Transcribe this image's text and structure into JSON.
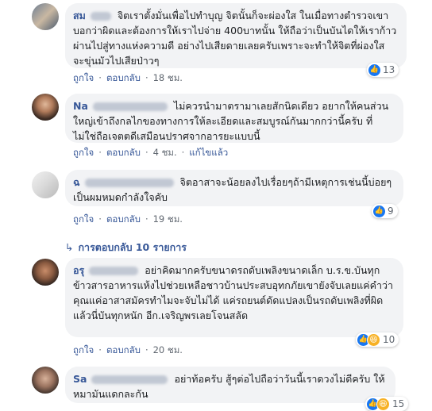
{
  "actions": {
    "like": "ถูกใจ",
    "reply": "ตอบกลับ",
    "edited": "แก้ไขแล้ว"
  },
  "comments": [
    {
      "name": "สม",
      "text": "จิตเราตั้งมั่นเพื่อไปทำบุญ จิตนั้นก็จะผ่องใส ในเมื่อทางตำรวจเขาบอกว่าผิดและต้องการให้เราไปจ่าย 400บาทนั้น ให้ถือว่าเป็นบันไดให้เราก้าวผ่านไปสู่ทางแห่งความดี อย่างไปเสียดายเลยครับเพราะจะทำให้จิตที่ผ่องใส จะขุ่นมัวไปเสียป่าวๆ",
      "time": "18 ชม.",
      "reactions": "13"
    },
    {
      "name": "Na",
      "text": "ไม่ควรนำมาตรามาเลยสักนิดเดียว อยากให้คนส่วนใหญ่เข้าถึงกลไกของทางการให้ละเอียดและสมบูรณ์กันมากกว่านี้ครับ ที่ไม่ใช่ถือเจตตดีเสมือนปราศจากอารยะแบบนี้",
      "time": "4 ชม.",
      "reactions": ""
    },
    {
      "name": "ฉ",
      "text": "จิตอาสาจะน้อยลงไปเรื่อยๆถ้ามีเหตุการเช่นนี้บ่อยๆ เป็นผมหมดกำลังใจคับ",
      "time": "19 ชม.",
      "reactions": "9"
    },
    {
      "name": "อรุ",
      "text": "อย่าคิดมากครับขนาดรถดับเพลิงขนาดเล็ก บ.ร.ข.บันทุกข้าวสารอาหารแห้งไปช่วยเหลือชาวบ้านประสบอุทกภัยเขายังจับเลยแค่คำว่าคุณแค่อาสาสมัครทำไมจะจับไม่ได้ แค่รถยนต์ดัดแปลงเป็นรถดับเพลิงที่ผิดแล้วนี่บันทุกหนัก อีก.เจริญพรเลยโจนสลัด",
      "time": "20 ชม.",
      "reactions": "10"
    },
    {
      "name": "Sa",
      "text": "อย่าท้อครับ สู้ๆต่อไปถือว่าวันนี้เราดวงไม่ดีครับ ให้หมามันแดกละกัน",
      "time": "",
      "reactions": "15"
    }
  ],
  "replies_link": "การตอบกลับ 10 รายการ"
}
